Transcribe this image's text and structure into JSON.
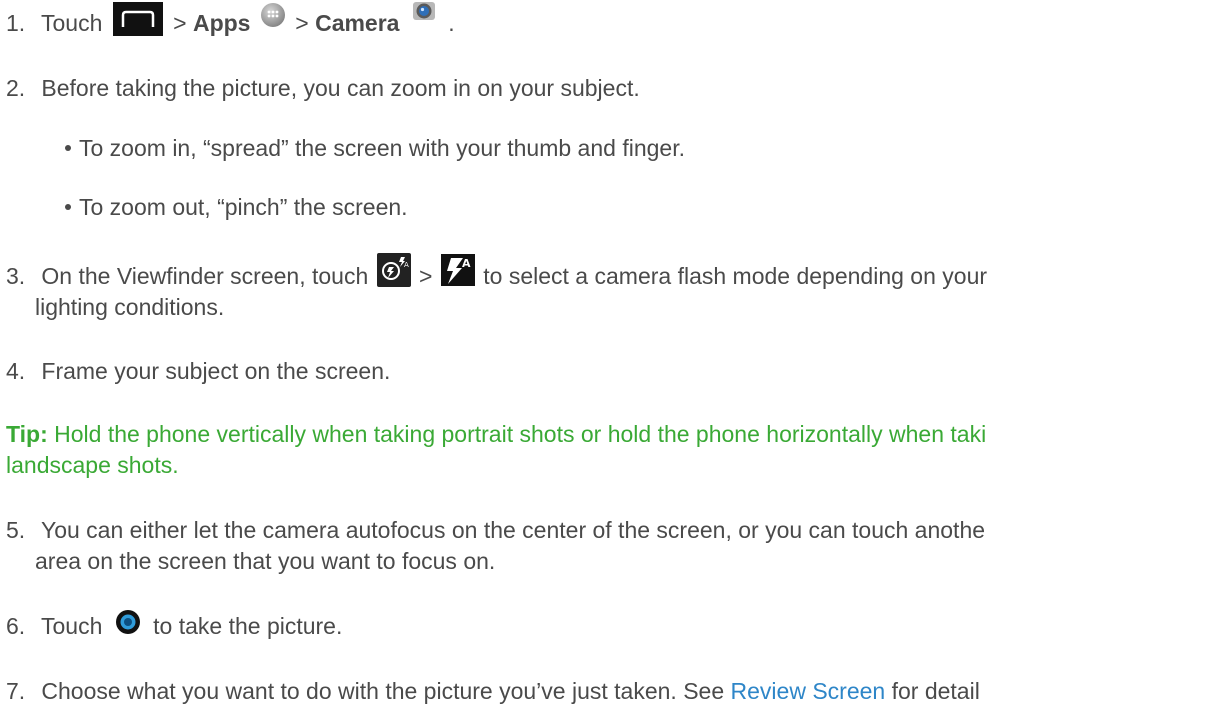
{
  "steps": {
    "s1": {
      "num": "1.",
      "touch": "Touch",
      "sep1": ">",
      "apps": "Apps",
      "sep2": ">",
      "camera": "Camera",
      "period": "."
    },
    "s2": {
      "num": "2.",
      "text": "Before taking the picture, you can zoom in on your subject."
    },
    "bullets": [
      "To zoom in, “spread” the screen with your thumb and finger.",
      "To zoom out, “pinch” the screen."
    ],
    "s3": {
      "num": "3.",
      "text_a": "On the Viewfinder screen, touch",
      "sep": ">",
      "text_b": "to select a camera flash mode depending on your",
      "text_c": "lighting conditions."
    },
    "s4": {
      "num": "4.",
      "text": "Frame your subject on the screen."
    },
    "tip": {
      "label": "Tip:",
      "text_a": "Hold the phone vertically when taking portrait shots or hold the phone horizontally when taki",
      "text_b": "landscape shots."
    },
    "s5": {
      "num": "5.",
      "text_a": "You can either let the camera autofocus on the center of the screen, or you can touch anothe",
      "text_b": "area on the screen that you want to focus on."
    },
    "s6": {
      "num": "6.",
      "touch": "Touch",
      "text": "to take the picture."
    },
    "s7": {
      "num": "7.",
      "text_a": "Choose what you want to do with the picture you’ve just taken. See",
      "link": "Review Screen",
      "text_b": "for detail"
    }
  },
  "icons": {
    "home": "home-button-icon",
    "apps": "apps-icon",
    "camera": "camera-app-icon",
    "flash_settings": "flash-settings-icon",
    "flash_auto": "flash-auto-icon",
    "shutter": "shutter-icon"
  },
  "colors": {
    "text": "#4a4a4a",
    "tip": "#3aa935",
    "link": "#2e86c8"
  }
}
